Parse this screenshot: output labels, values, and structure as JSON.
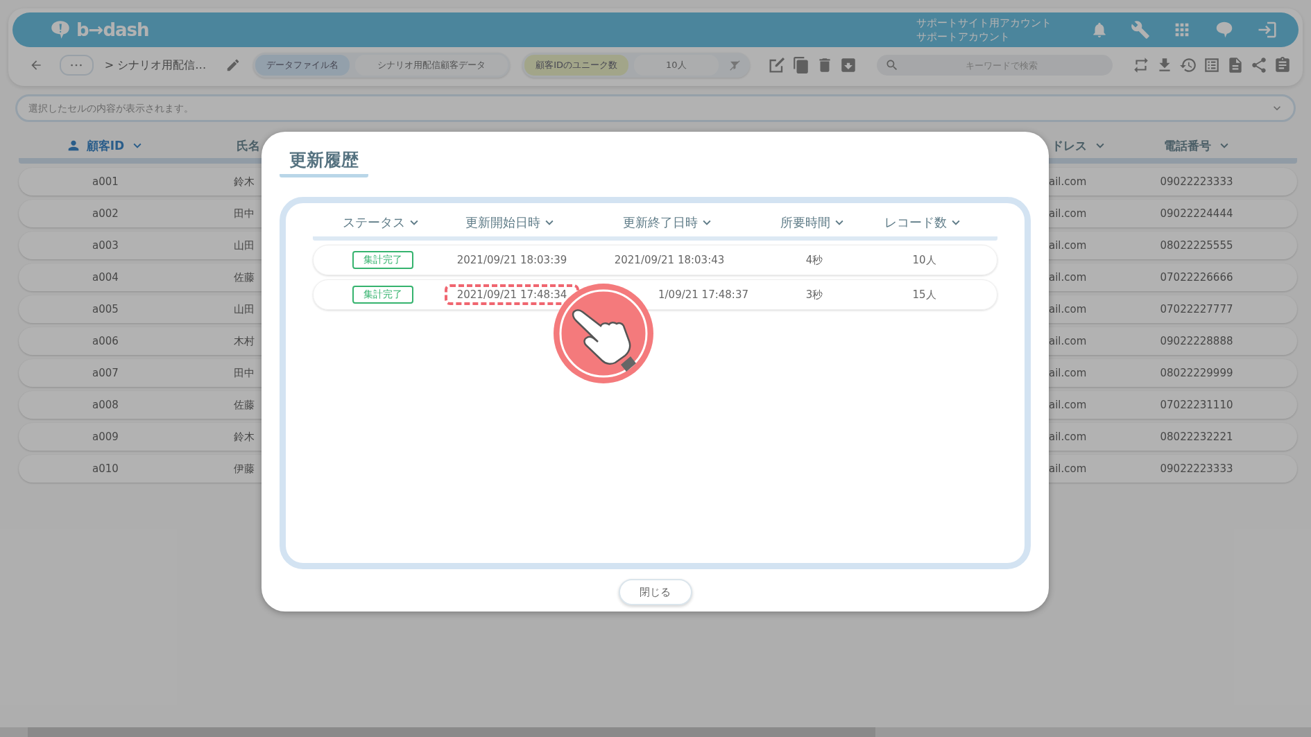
{
  "header": {
    "logo": "b→dash",
    "account": [
      "サポートサイト用アカウント",
      "サポートアカウント"
    ]
  },
  "toolbar": {
    "breadcrumb": "> シナリオ用配信…",
    "filters": [
      {
        "label": "データファイル名",
        "value": "シナリオ用配信顧客データ",
        "kind": "name"
      },
      {
        "label": "顧客IDのユニーク数",
        "value": "10人",
        "kind": "count"
      }
    ],
    "search": {
      "placeholder": "キーワードで検索"
    }
  },
  "cell_bar": {
    "placeholder": "選択したセルの内容が表示されます。"
  },
  "table": {
    "columns": [
      {
        "label": "顧客ID",
        "kind": "key",
        "chevron": true
      },
      {
        "label": "氏名",
        "kind": "plain",
        "chevron": false
      },
      {
        "label": "ドレス",
        "kind": "plain",
        "chevron": true
      },
      {
        "label": "電話番号",
        "kind": "plain",
        "chevron": true
      }
    ],
    "rows": [
      {
        "id": "a001",
        "name": "鈴木",
        "email": "ail.com",
        "phone": "09022223333"
      },
      {
        "id": "a002",
        "name": "田中",
        "email": "ail.com",
        "phone": "09022224444"
      },
      {
        "id": "a003",
        "name": "山田",
        "email": "ail.com",
        "phone": "08022225555"
      },
      {
        "id": "a004",
        "name": "佐藤",
        "email": "ail.com",
        "phone": "07022226666"
      },
      {
        "id": "a005",
        "name": "山田",
        "email": "ail.com",
        "phone": "07022227777"
      },
      {
        "id": "a006",
        "name": "木村",
        "email": "ail.com",
        "phone": "09022228888"
      },
      {
        "id": "a007",
        "name": "田中",
        "email": "ail.com",
        "phone": "08022229999"
      },
      {
        "id": "a008",
        "name": "佐藤",
        "email": "ail.com",
        "phone": "07022231110"
      },
      {
        "id": "a009",
        "name": "鈴木",
        "email": "ail.com",
        "phone": "08022232221"
      },
      {
        "id": "a010",
        "name": "伊藤",
        "email": "ail.com",
        "phone": "09022223333"
      }
    ]
  },
  "dialog": {
    "title": "更新履歴",
    "columns": [
      "ステータス",
      "更新開始日時",
      "更新終了日時",
      "所要時間",
      "レコード数"
    ],
    "rows": [
      {
        "status": "集計完了",
        "start": "2021/09/21 18:03:39",
        "end": "2021/09/21 18:03:43",
        "duration": "4秒",
        "records": "10人",
        "start_highlighted": false
      },
      {
        "status": "集計完了",
        "start": "2021/09/21 17:48:34",
        "end": "1/09/21 17:48:37",
        "duration": "3秒",
        "records": "15人",
        "start_highlighted": true
      }
    ],
    "close_button": "閉じる"
  }
}
